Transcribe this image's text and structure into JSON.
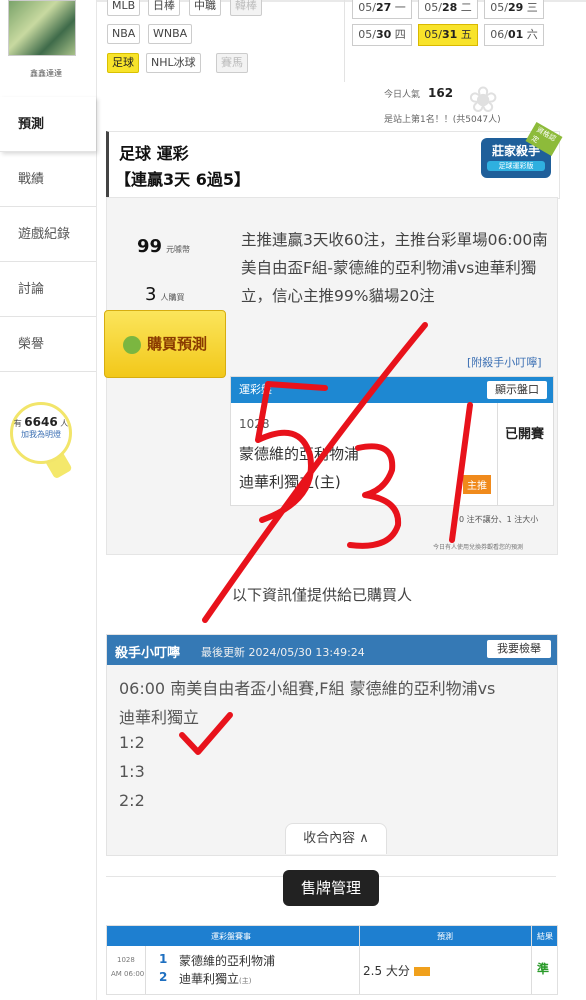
{
  "sidebar": {
    "user_name": "鑫鑫達達",
    "items": [
      "預測",
      "戰績",
      "遊戲紀錄",
      "討論",
      "榮譽"
    ],
    "bulb_prefix": "有",
    "bulb_count": "6646",
    "bulb_suffix": "人",
    "bulb_text": "加我為明燈"
  },
  "filters": {
    "row1": [
      "MLB",
      "日棒",
      "中職",
      "韓棒"
    ],
    "row2": [
      "NBA",
      "WNBA"
    ],
    "row3": [
      "足球",
      "NHL冰球",
      "賽馬"
    ]
  },
  "dates": [
    {
      "md": "05/",
      "d": "27",
      "wd": "一"
    },
    {
      "md": "05/",
      "d": "28",
      "wd": "二"
    },
    {
      "md": "05/",
      "d": "29",
      "wd": "三"
    },
    {
      "md": "05/",
      "d": "30",
      "wd": "四"
    },
    {
      "md": "05/",
      "d": "31",
      "wd": "五"
    },
    {
      "md": "06/",
      "d": "01",
      "wd": "六"
    }
  ],
  "popularity": {
    "label": "今日人氣",
    "value": "162",
    "rank": "是站上第1名！！(共5047人)"
  },
  "card": {
    "title": "足球 運彩",
    "streak": "【連贏3天 6過5】",
    "badge_main": "莊家殺手",
    "badge_sub": "足球運彩版",
    "badge_ribbon": "資格認定",
    "price": "99",
    "price_unit": "元噱幣",
    "buyers": "3",
    "buyers_unit": "人購買",
    "buy_button": "購買預測",
    "description": "主推連贏3天收60注，主推台彩單場06:00南美自由盃F組-蒙德維的亞利物浦vs迪華利獨立，信心主推99%貓場20注",
    "tips_link": "[附殺手小叮嚀]",
    "lottery_label": "運彩盤",
    "show_odds": "顯示盤口",
    "match_no": "1028",
    "team1": "蒙德維的亞利物浦",
    "team2": "迪華利獨立(主)",
    "host_tag": "主推",
    "status": "已開賽",
    "note": "0 注不讓分、1 注大小",
    "note2": "今日有人使用兌換券觀看您的預測",
    "info": "以下資訊僅提供給已購買人"
  },
  "tips": {
    "title": "殺手小叮嚀",
    "updated": "最後更新 2024/05/30 13:49:24",
    "report": "我要檢舉",
    "lines": [
      "06:00 南美自由者盃小組賽,F組 蒙德維的亞利物浦vs",
      "迪華利獨立",
      "1:2",
      "1:3",
      "2:2"
    ],
    "collapse": "收合內容 ∧"
  },
  "sell_button": "售牌管理",
  "records": {
    "headers": [
      "運彩盤賽事",
      "預測",
      "結果"
    ],
    "row": {
      "no": "1028",
      "time": "AM 06:00",
      "idx1": "1",
      "idx2": "2",
      "team1": "蒙德維的亞利物浦",
      "team2": "迪華利獨立",
      "team2_tag": "(主)",
      "pick": "2.5 大分",
      "result": "準"
    }
  },
  "colors": {
    "accent_yellow": "#f8e32a",
    "blue": "#1e88d2",
    "red_mark": "#e8121b"
  }
}
